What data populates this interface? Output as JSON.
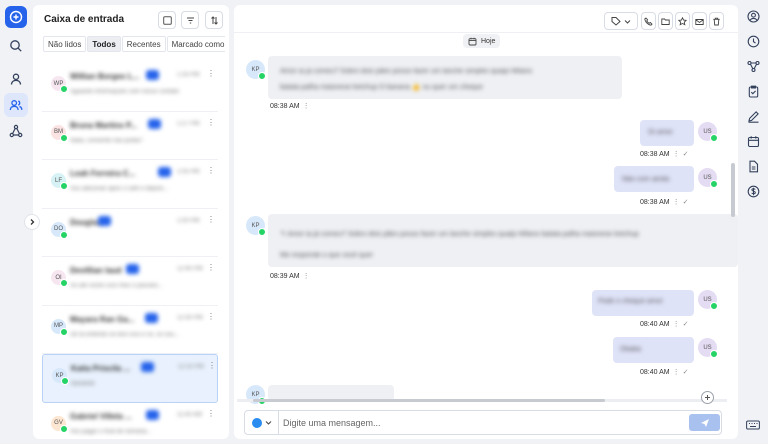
{
  "inbox": {
    "title": "Caixa de entrada",
    "tabs": [
      {
        "label": "Não lidos",
        "active": false
      },
      {
        "label": "Todos",
        "active": true
      },
      {
        "label": "Recentes",
        "active": false
      },
      {
        "label": "Marcado como",
        "active": false
      }
    ],
    "conversations": [
      {
        "initials": "WP",
        "name": "Willian Borges L...",
        "time": "1:33 PM",
        "preview": "Aguarde informações com nosso contato",
        "avatar_color": "#f6e6f0",
        "selected": false
      },
      {
        "initials": "BM",
        "name": "Bruna Martins P...",
        "time": "1:27 PM",
        "preview": "Nalia, consente não podia?",
        "avatar_color": "#fbe3e3",
        "selected": false
      },
      {
        "initials": "LF",
        "name": "Leah Ferreira C...",
        "time": "1:05 PM",
        "preview": "Vou adicionar após o café e depois...",
        "avatar_color": "#d6f2f5",
        "selected": false
      },
      {
        "initials": "DO",
        "name": "Douglas",
        "time": "1:00 PM",
        "preview": "",
        "avatar_color": "#d7e8fb",
        "selected": false
      },
      {
        "initials": "OI",
        "name": "Devillian laud",
        "time": "12:40 PM",
        "preview": "Só até vocês isso meu o passeio...",
        "avatar_color": "#f6e6f0",
        "selected": false
      },
      {
        "initials": "MP",
        "name": "Mayara Ran Ga...",
        "time": "12:30 PM",
        "preview": "Ok tá entendo se Box isso e só, só sou...",
        "avatar_color": "#d7e8fb",
        "selected": false
      },
      {
        "initials": "KP",
        "name": "Katia Priscila ...",
        "time": "12:10 PM",
        "preview": "Bastante",
        "avatar_color": "#d7e8fb",
        "selected": true
      },
      {
        "initials": "GV",
        "name": "Gabriel Villela ...",
        "time": "11:40 AM",
        "preview": "Vou pagar o final de semana...",
        "avatar_color": "#fde6d2",
        "selected": false
      }
    ]
  },
  "chat": {
    "date_label": "Hoje",
    "messages": [
      {
        "dir": "in",
        "avatar": "KP",
        "text": "Amor ia já comeu? Sobro dois pães posso fazer um lanche simples quaijo Milano",
        "text2": "batata palha maionese ketchup O banana 👍 ou quer um cheque",
        "time": "08:38 AM",
        "check": false
      },
      {
        "dir": "out",
        "avatar": "US",
        "text": "Oi amor",
        "text2": "",
        "time": "08:38 AM",
        "check": true
      },
      {
        "dir": "out",
        "avatar": "US",
        "text": "Não com ainda",
        "text2": "",
        "time": "08:38 AM",
        "check": true
      },
      {
        "dir": "in",
        "avatar": "KP",
        "text": "↰ Amor ia já comeu? Sobro dois pães posso fazer um lanche simples quaijo Milano batata palha maionese ketchup",
        "text2": "Me responde o que você quer",
        "time": "08:39 AM",
        "check": false
      },
      {
        "dir": "out",
        "avatar": "US",
        "text": "Pode o cheque amor",
        "text2": "",
        "time": "08:40 AM",
        "check": true
      },
      {
        "dir": "out",
        "avatar": "US",
        "text": "Obaba",
        "text2": "",
        "time": "08:40 AM",
        "check": true
      },
      {
        "dir": "in",
        "avatar": "KP",
        "text": "",
        "text2": "",
        "time": "",
        "check": false
      }
    ],
    "composer": {
      "placeholder": "Digite uma mensagem..."
    }
  },
  "colors": {
    "accent": "#2563eb",
    "whatsapp": "#25d366",
    "outgoing_bubble": "#dfe3f8",
    "incoming_bubble": "#eef0f4"
  },
  "icons": {
    "left_rail": [
      "add-chat-icon",
      "search-icon",
      "user-icon",
      "users-icon",
      "network-icon"
    ],
    "chat_toolbar": [
      "tag-icon",
      "chevron-down-icon",
      "phone-icon",
      "folder-icon",
      "star-icon",
      "mail-icon",
      "trash-icon"
    ],
    "right_rail": [
      "user-circle-icon",
      "history-icon",
      "flow-icon",
      "clipboard-icon",
      "pen-icon",
      "calendar-icon",
      "file-icon",
      "dollar-icon",
      "keyboard-icon"
    ]
  }
}
